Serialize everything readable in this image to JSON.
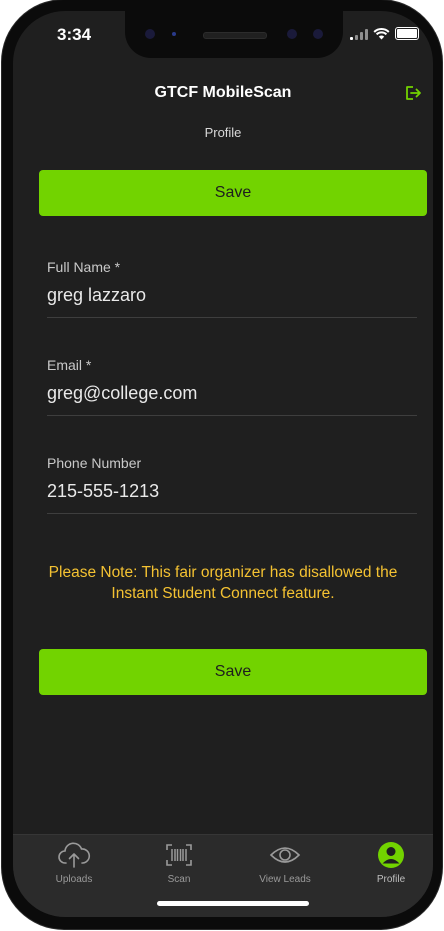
{
  "status_bar": {
    "time": "3:34"
  },
  "header": {
    "title": "GTCF MobileScan",
    "subtitle": "Profile"
  },
  "profile_form": {
    "save_label_top": "Save",
    "save_label_bottom": "Save",
    "fields": [
      {
        "label": "Full Name *",
        "value": "greg lazzaro"
      },
      {
        "label": "Email *",
        "value": "greg@college.com"
      },
      {
        "label": "Phone Number",
        "value": "215-555-1213"
      }
    ],
    "note": "Please Note: This fair organizer has disallowed the Instant Student Connect feature."
  },
  "tabbar": {
    "items": [
      {
        "label": "Uploads",
        "icon": "cloud-upload-icon"
      },
      {
        "label": "Scan",
        "icon": "barcode-icon"
      },
      {
        "label": "View Leads",
        "icon": "eye-icon"
      },
      {
        "label": "Profile",
        "icon": "user-circle-icon"
      }
    ],
    "active_index": 3
  },
  "colors": {
    "accent": "#72d300",
    "background": "#1f1f1f",
    "tabbar": "#2b2b2b",
    "note": "#f4c232"
  }
}
